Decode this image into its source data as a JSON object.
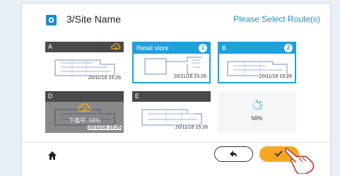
{
  "header": {
    "site_name": "3/Site Name",
    "prompt": "Please Select Route(s)"
  },
  "routes": [
    {
      "label": "A",
      "date": "20/11/16 15:26",
      "state": "cloud"
    },
    {
      "label": "Retail store",
      "date": "20/11/16 15:26",
      "state": "selected",
      "order": "1"
    },
    {
      "label": "B",
      "date": "20/11/16 15:26",
      "state": "selected",
      "order": "2"
    },
    {
      "label": "D",
      "date": "20/11/16 15:26",
      "state": "downloading",
      "status_text": "下载中..56%"
    },
    {
      "label": "E",
      "date": "20/11/16 15:26",
      "state": "normal"
    },
    {
      "label": "",
      "state": "loading",
      "progress_text": "56%"
    }
  ],
  "footer": {
    "home_icon": "home-icon",
    "back_icon": "arrow-back-icon",
    "confirm_icon": "check-icon"
  },
  "colors": {
    "accent": "#1ea0dc",
    "confirm": "#f5a623",
    "tile_bar": "#4a4a4a"
  }
}
